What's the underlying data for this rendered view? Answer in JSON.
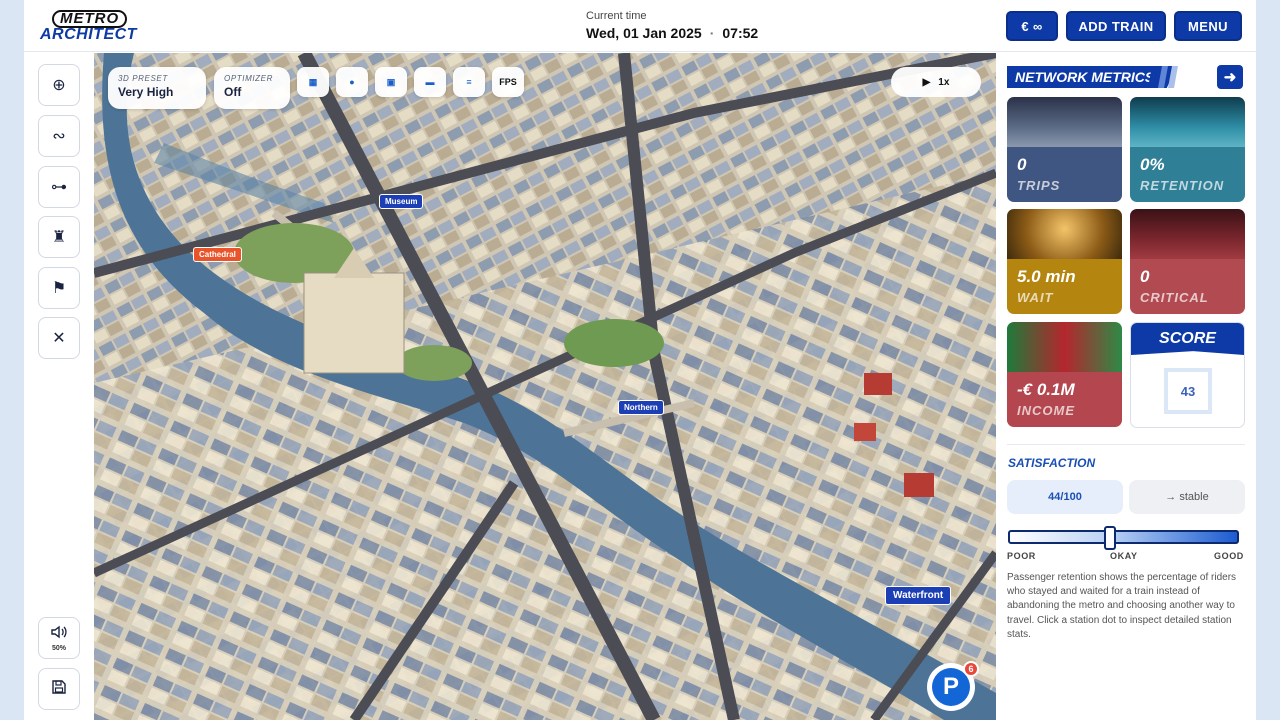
{
  "header": {
    "logo_top": "METRO",
    "logo_bottom": "ARCHITECT",
    "time_label": "Current time",
    "date": "Wed, 01 Jan 2025",
    "clock": "07:52",
    "currency_button": "€ ∞",
    "add_train_button": "ADD TRAIN",
    "menu_button": "MENU"
  },
  "toolbar": {
    "tools": [
      {
        "icon": "add-circle-icon",
        "glyph": "⊕"
      },
      {
        "icon": "route-icon",
        "glyph": "∾"
      },
      {
        "icon": "connect-icon",
        "glyph": "⊶"
      },
      {
        "icon": "tower-icon",
        "glyph": "♜"
      },
      {
        "icon": "flag-icon",
        "glyph": "⚑"
      },
      {
        "icon": "close-icon",
        "glyph": "✕"
      }
    ],
    "volume_label": "50%",
    "volume_icon": "speaker-icon",
    "save_icon": "save-icon"
  },
  "map": {
    "preset_label": "3D PRESET",
    "preset_value": "Very High",
    "optimizer_label": "OPTIMIZER",
    "optimizer_value": "Off",
    "fps_label": "FPS",
    "speed_label": "1x",
    "stations": {
      "museum": "Museum",
      "cathedral": "Cathedral",
      "northern": "Northern",
      "waterfront": "Waterfront"
    },
    "parking_badge": "P",
    "parking_count": "6"
  },
  "panel": {
    "title": "NETWORK METRICS",
    "metrics": [
      {
        "value": "0",
        "label": "TRIPS",
        "color": "#3f5683"
      },
      {
        "value": "0%",
        "label": "RETENTION",
        "color": "#2f7f96"
      },
      {
        "value": "5.0 min",
        "label": "WAIT",
        "color": "#b5860f"
      },
      {
        "value": "0",
        "label": "CRITICAL",
        "color": "#b24a52"
      },
      {
        "value": "-€ 0.1M",
        "label": "INCOME",
        "color": "#b3464e"
      }
    ],
    "score_title": "SCORE",
    "score_value": "43",
    "satisfaction_title": "SATISFACTION",
    "satisfaction_value": "44/100",
    "satisfaction_trend": "→ stable",
    "satisfaction_level": 0.44,
    "scale_poor": "POOR",
    "scale_okay": "OKAY",
    "scale_good": "GOOD",
    "description": "Passenger retention shows the percentage of riders who stayed and waited for a train instead of abandoning the metro and choosing another way to travel. Click a station dot to inspect detailed station stats."
  }
}
